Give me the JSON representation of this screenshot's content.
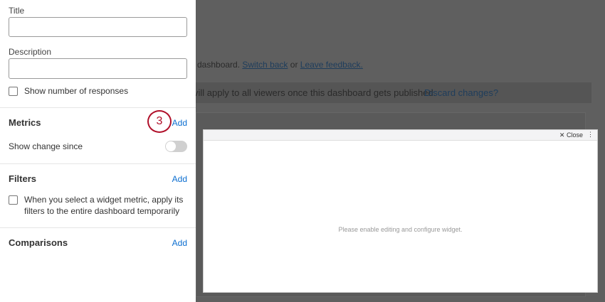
{
  "panel": {
    "title_label": "Title",
    "title_value": "",
    "description_label": "Description",
    "description_value": "",
    "show_responses": "Show number of responses",
    "metrics": {
      "heading": "Metrics",
      "add": "Add",
      "step_number": "3",
      "show_change": "Show change since",
      "toggle_on": false
    },
    "filters": {
      "heading": "Filters",
      "add": "Add",
      "checkbox_text": "When you select a widget metric, apply its filters to the entire dashboard temporarily"
    },
    "comparisons": {
      "heading": "Comparisons",
      "add": "Add"
    }
  },
  "background": {
    "notice_prefix": "dashboard.",
    "switch_back": "Switch back",
    "or": "or",
    "leave_feedback": "Leave feedback.",
    "banner_text": "vill apply to all viewers once this dashboard gets published.",
    "discard": "Discard changes?"
  },
  "widget": {
    "close": "Close",
    "message": "Please enable editing and configure widget."
  }
}
